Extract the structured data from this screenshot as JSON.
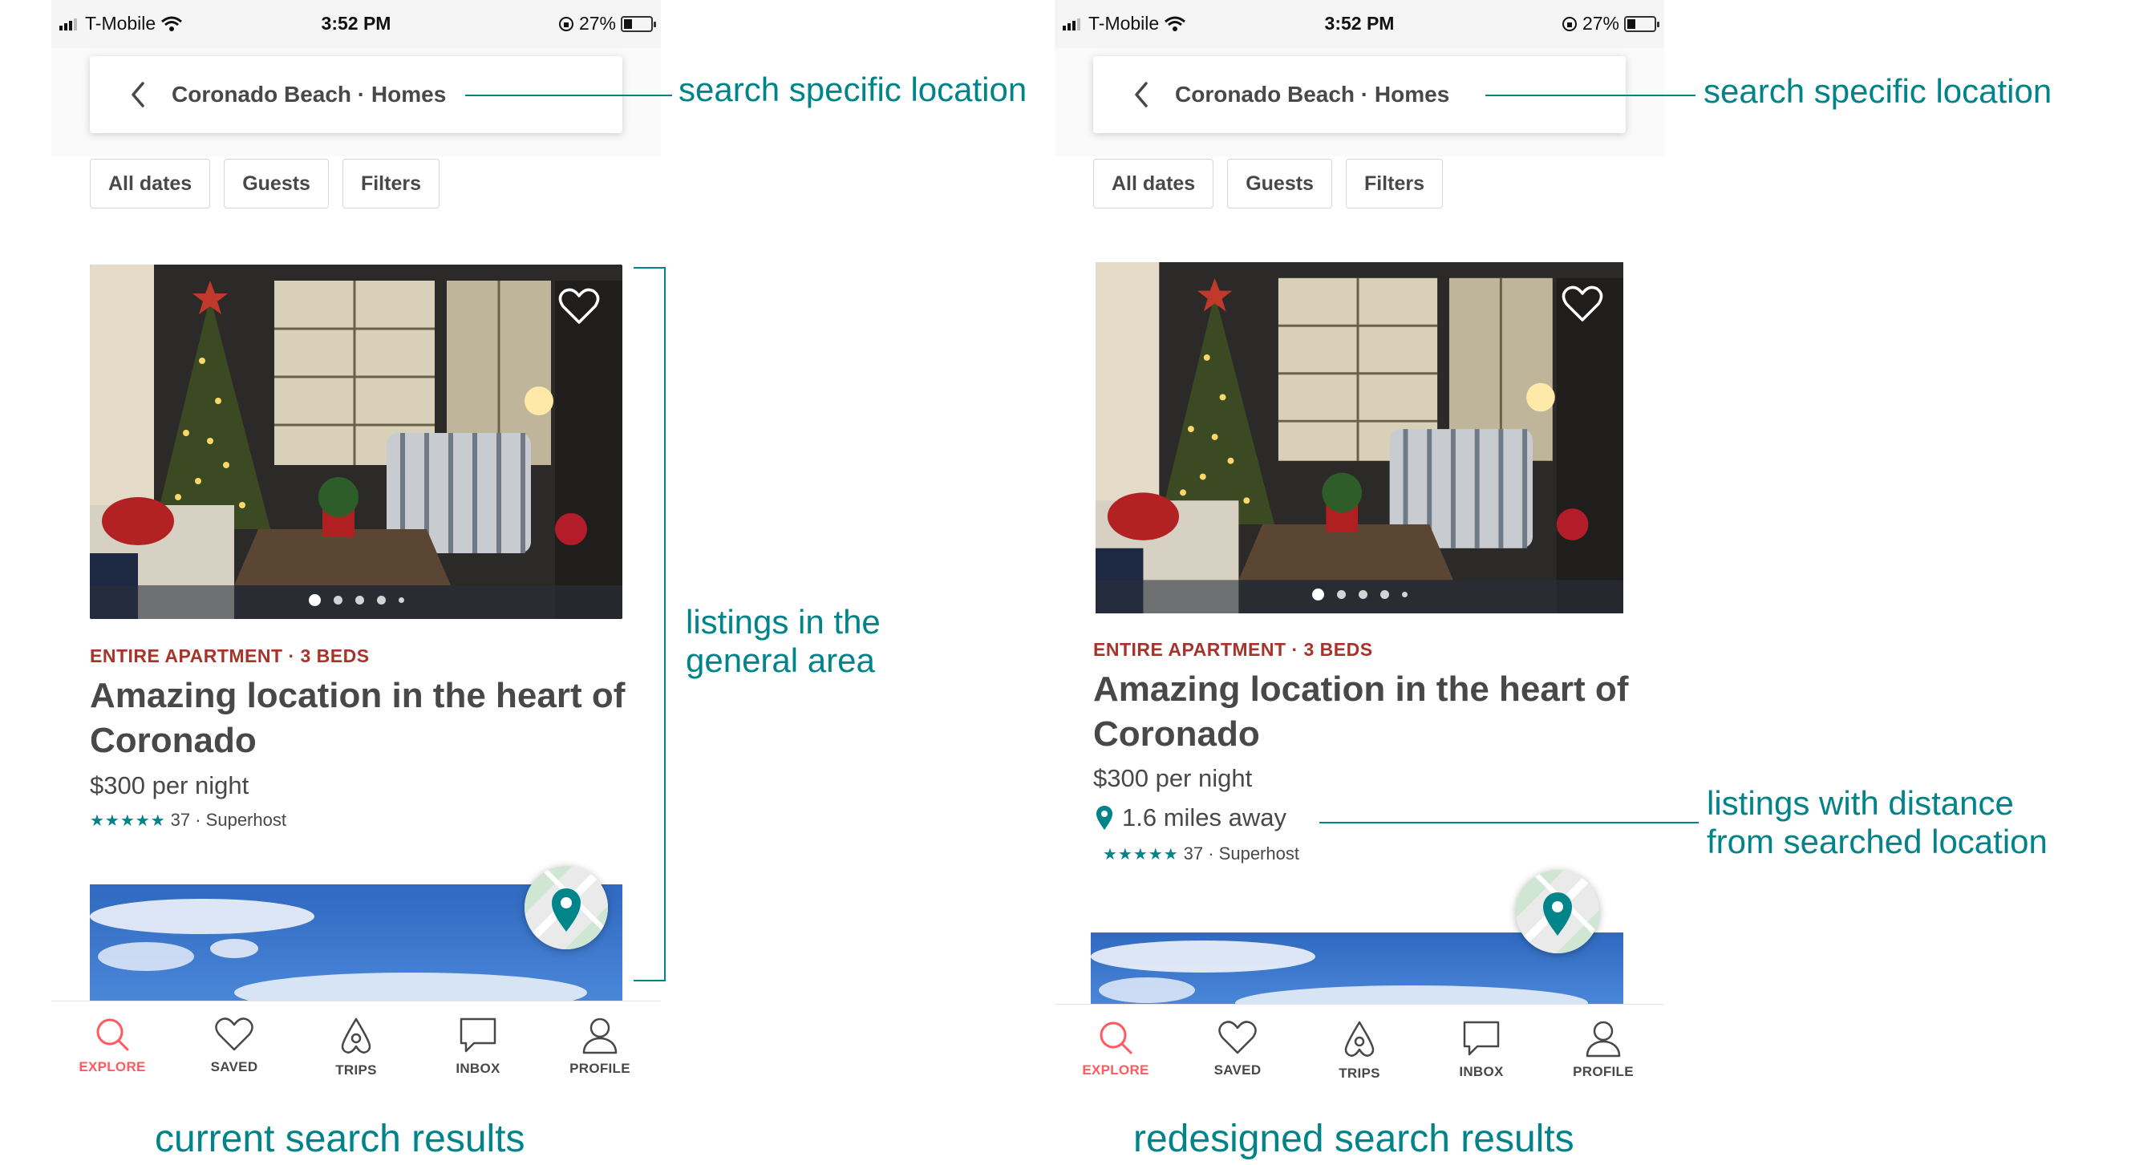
{
  "status_bar": {
    "carrier": "T-Mobile",
    "time": "3:52 PM",
    "battery": "27%"
  },
  "search": {
    "title": "Coronado Beach · Homes"
  },
  "filters": [
    "All dates",
    "Guests",
    "Filters"
  ],
  "listing": {
    "type": "ENTIRE APARTMENT · 3 BEDS",
    "title": "Amazing location in the heart of Coronado",
    "price": "$300 per night",
    "stars": "★★★★★",
    "reviews": "37 · Superhost",
    "distance": "1.6 miles away"
  },
  "tabs": [
    {
      "label": "EXPLORE",
      "icon": "search-icon",
      "active": true
    },
    {
      "label": "SAVED",
      "icon": "heart-icon"
    },
    {
      "label": "TRIPS",
      "icon": "airbnb-logo-icon"
    },
    {
      "label": "INBOX",
      "icon": "chat-icon"
    },
    {
      "label": "PROFILE",
      "icon": "user-icon"
    }
  ],
  "annotations": {
    "search_specific": "search specific location",
    "general_area_1": "listings in the",
    "general_area_2": "general area",
    "distance_1": "listings with distance",
    "distance_2": "from searched location",
    "caption_current": "current search results",
    "caption_redesigned": "redesigned search results"
  },
  "colors": {
    "teal": "#008489",
    "red": "#a8332a",
    "active_tab": "#ff5a5f"
  }
}
